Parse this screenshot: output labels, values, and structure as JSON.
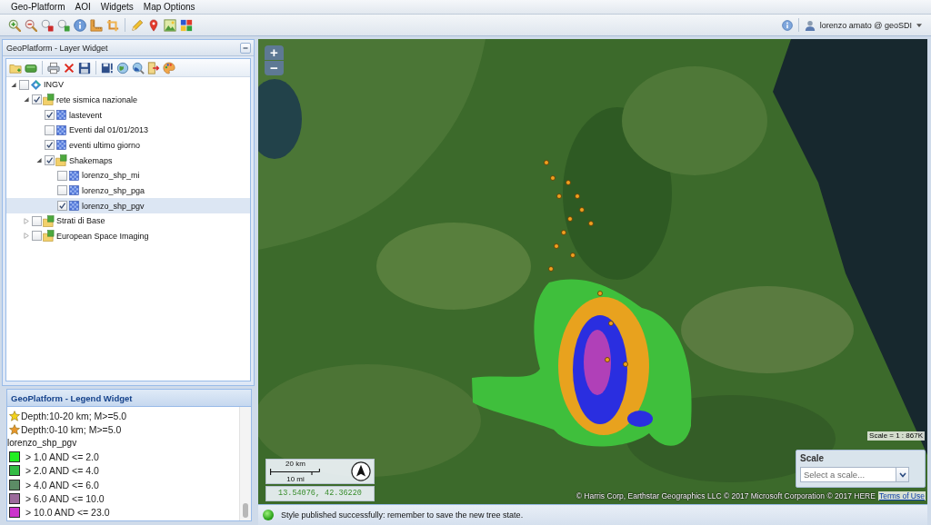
{
  "menu_bar": {
    "items": [
      "Geo-Platform",
      "AOI",
      "Widgets",
      "Map Options"
    ]
  },
  "user": {
    "name": "lorenzo amato @ geoSDI"
  },
  "layer_widget": {
    "title": "GeoPlatform - Layer Widget",
    "tree": [
      {
        "label": "INGV",
        "kind": "root",
        "checked": false,
        "expanded": true,
        "selected": false,
        "children": [
          {
            "label": "rete sismica nazionale",
            "kind": "folder",
            "checked": true,
            "expanded": true,
            "selected": false,
            "children": [
              {
                "label": "lastevent",
                "kind": "layer",
                "checked": true,
                "selected": false
              },
              {
                "label": "Eventi dal 01/01/2013",
                "kind": "layer",
                "checked": false,
                "selected": false
              },
              {
                "label": "eventi ultimo giorno",
                "kind": "layer",
                "checked": true,
                "selected": false
              },
              {
                "label": "Shakemaps",
                "kind": "folder",
                "checked": true,
                "expanded": true,
                "selected": false,
                "children": [
                  {
                    "label": "lorenzo_shp_mi",
                    "kind": "layer",
                    "checked": false,
                    "selected": false
                  },
                  {
                    "label": "lorenzo_shp_pga",
                    "kind": "layer",
                    "checked": false,
                    "selected": false
                  },
                  {
                    "label": "lorenzo_shp_pgv",
                    "kind": "layer",
                    "checked": true,
                    "selected": true
                  }
                ]
              }
            ]
          },
          {
            "label": "Strati di Base",
            "kind": "folder",
            "checked": false,
            "expanded": false,
            "selected": false
          },
          {
            "label": "European Space Imaging",
            "kind": "folder",
            "checked": false,
            "expanded": false,
            "selected": false
          }
        ]
      }
    ]
  },
  "legend_widget": {
    "title": "GeoPlatform - Legend Widget",
    "items": [
      {
        "kind": "star",
        "label": "Depth:10-20 km; M>=5.0",
        "color": "#f2d21a"
      },
      {
        "kind": "star",
        "label": "Depth:0-10 km; M>=5.0",
        "color": "#e8962a"
      },
      {
        "kind": "heading",
        "label": "lorenzo_shp_pgv"
      },
      {
        "kind": "swatch",
        "label": "> 1.0 AND <= 2.0",
        "color": "#22ee22"
      },
      {
        "kind": "swatch",
        "label": "> 2.0 AND <= 4.0",
        "color": "#33bb44"
      },
      {
        "kind": "swatch",
        "label": "> 4.0 AND <= 6.0",
        "color": "#5c8c66"
      },
      {
        "kind": "swatch",
        "label": "> 6.0 AND <= 10.0",
        "color": "#9c6a9c"
      },
      {
        "kind": "swatch",
        "label": "> 10.0 AND <= 23.0",
        "color": "#cc33cc"
      }
    ]
  },
  "map": {
    "zoom_in": "+",
    "zoom_out": "−",
    "scale_bar": {
      "metric": "20 km",
      "imperial": "10 mi"
    },
    "coordinates": "13.54076, 42.36220",
    "scale_ratio": "Scale = 1 : 867K",
    "scale_panel": {
      "title": "Scale",
      "placeholder": "Select a scale..."
    },
    "attribution": "© Harris Corp, Earthstar Geographics LLC © 2017 Microsoft Corporation © 2017 HERE",
    "terms_link": "Terms of Use"
  },
  "status_bar": {
    "message": "Style published successfully: remember to save the new tree state."
  }
}
